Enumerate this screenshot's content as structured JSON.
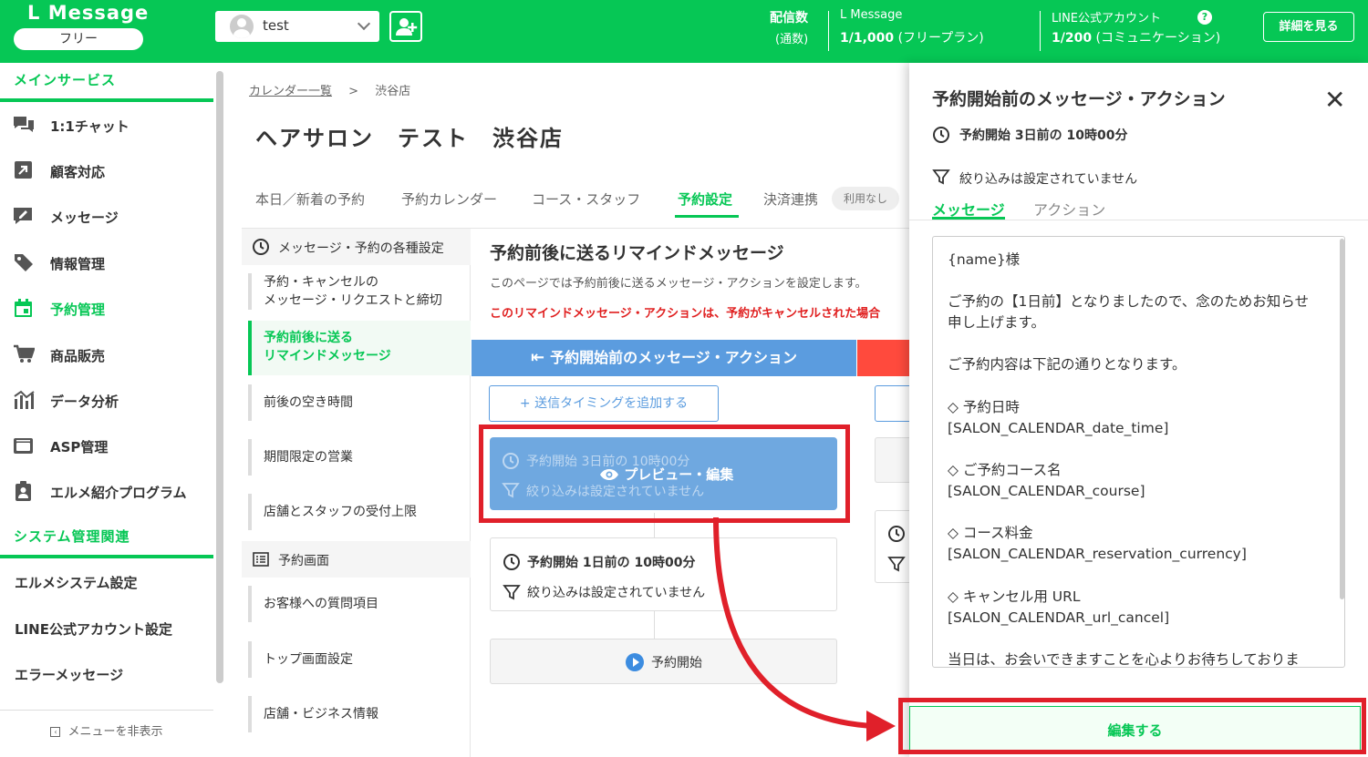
{
  "header": {
    "logo": "L Message",
    "plan": "フリー",
    "account_name": "test",
    "deliveries_label_1": "配信数",
    "deliveries_label_2": "(通数)",
    "lmessage_label": "L Message",
    "lmessage_value": "1/1,000",
    "lmessage_plan": "(フリープラン)",
    "line_label": "LINE公式アカウント",
    "line_value": "1/200",
    "line_plan": "(コミュニケーション)",
    "help": "?",
    "detail_button": "詳細を見る"
  },
  "sidebar": {
    "main_section": "メインサービス",
    "items": [
      {
        "label": "1:1チャット",
        "icon": "chat-icon"
      },
      {
        "label": "顧客対応",
        "icon": "arrow-box-icon"
      },
      {
        "label": "メッセージ",
        "icon": "message-edit-icon"
      },
      {
        "label": "情報管理",
        "icon": "tag-icon"
      },
      {
        "label": "予約管理",
        "icon": "calendar-icon"
      },
      {
        "label": "商品販売",
        "icon": "cart-icon"
      },
      {
        "label": "データ分析",
        "icon": "chart-icon"
      },
      {
        "label": "ASP管理",
        "icon": "asp-icon"
      },
      {
        "label": "エルメ紹介プログラム",
        "icon": "clipboard-icon"
      }
    ],
    "system_section": "システム管理関連",
    "system_items": [
      "エルメシステム設定",
      "LINE公式アカウント設定",
      "エラーメッセージ"
    ],
    "hide_menu": "メニューを非表示"
  },
  "main": {
    "breadcrumb_link": "カレンダー一覧",
    "breadcrumb_sep": ">",
    "breadcrumb_current": "渋谷店",
    "title": "ヘアサロン　テスト　渋谷店",
    "tabs": [
      "本日／新着の予約",
      "予約カレンダー",
      "コース・スタッフ",
      "予約設定",
      "決済連携"
    ],
    "tab_badge": "利用なし",
    "left_nav": {
      "head1": "メッセージ・予約の各種設定",
      "items1": [
        {
          "line1": "予約・キャンセルの",
          "line2": "メッセージ・リクエストと締切"
        },
        {
          "line1": "予約前後に送る",
          "line2": "リマインドメッセージ"
        },
        {
          "line1": "前後の空き時間",
          "line2": ""
        },
        {
          "line1": "期間限定の営業",
          "line2": ""
        },
        {
          "line1": "店舗とスタッフの受付上限",
          "line2": ""
        }
      ],
      "head2": "予約画面",
      "items2": [
        "お客様への質問項目",
        "トップ画面設定",
        "店舗・ビジネス情報"
      ]
    },
    "content_title": "予約前後に送るリマインドメッセージ",
    "content_desc": "このページでは予約前後に送るメッセージ・アクションを設定します。",
    "content_warning": "このリマインドメッセージ・アクションは、予約がキャンセルされた場合",
    "before_bar": "予約開始前のメッセージ・アクション",
    "add_timing": "+ 送信タイミングを追加する",
    "card1_timing": "予約開始 3日前の 10時00分",
    "card1_filter": "絞り込みは設定されていません",
    "card1_overlay": "プレビュー・編集",
    "card2_timing": "予約開始 1日前の 10時00分",
    "card2_filter": "絞り込みは設定されていません",
    "start_label": "予約開始"
  },
  "panel": {
    "title": "予約開始前のメッセージ・アクション",
    "close": "✕",
    "timing": "予約開始 3日前の 10時00分",
    "filter": "絞り込みは設定されていません",
    "tab_message": "メッセージ",
    "tab_action": "アクション",
    "message_text": "{name}様\n\nご予約の【1日前】となりましたので、念のためお知らせ\n申し上げます。\n\nご予約内容は下記の通りとなります。\n\n◇ 予約日時\n[SALON_CALENDAR_date_time]\n\n◇ ご予約コース名\n[SALON_CALENDAR_course]\n\n◇ コース料金\n[SALON_CALENDAR_reservation_currency]\n\n◇ キャンセル用 URL\n[SALON_CALENDAR_url_cancel]\n\n当日は、お会いできますことを心よりお待ちしておりま",
    "edit_button": "編集する"
  },
  "colors": {
    "brand": "#06c755",
    "accent_blue": "#5b9cdf",
    "highlight_red": "#e0202a"
  }
}
